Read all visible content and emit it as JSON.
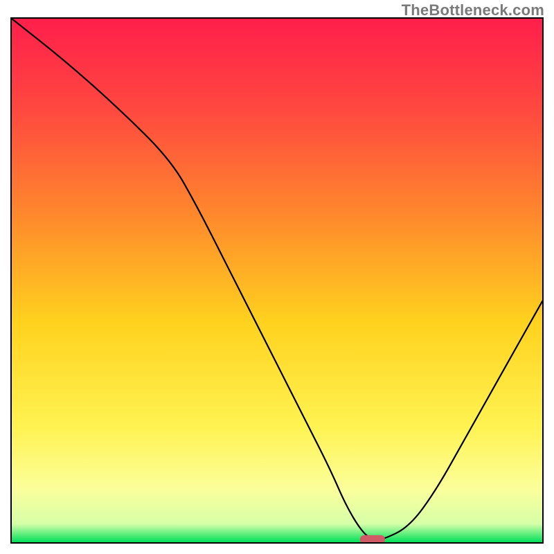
{
  "watermark": "TheBottleneck.com",
  "colors": {
    "gradient_stops": [
      {
        "offset": 0.0,
        "color": "#ff1f4b"
      },
      {
        "offset": 0.18,
        "color": "#ff4a3f"
      },
      {
        "offset": 0.38,
        "color": "#ff8a2c"
      },
      {
        "offset": 0.58,
        "color": "#ffd21e"
      },
      {
        "offset": 0.78,
        "color": "#fff352"
      },
      {
        "offset": 0.9,
        "color": "#fbff9c"
      },
      {
        "offset": 0.965,
        "color": "#d6ffa8"
      },
      {
        "offset": 1.0,
        "color": "#00e05a"
      }
    ],
    "curve": "#000000",
    "marker": "#d05a66",
    "frame": "#000000"
  },
  "chart_data": {
    "type": "line",
    "title": "",
    "xlabel": "",
    "ylabel": "",
    "xlim": [
      0,
      100
    ],
    "ylim": [
      0,
      100
    ],
    "legend": false,
    "grid": false,
    "x": [
      0,
      10,
      20,
      30,
      35,
      40,
      45,
      50,
      55,
      60,
      63,
      66,
      68,
      70,
      75,
      80,
      85,
      90,
      95,
      100
    ],
    "values": [
      100,
      92,
      83,
      73,
      64,
      54,
      44,
      34,
      24,
      14,
      7,
      2,
      0.5,
      0.5,
      3,
      10,
      19,
      28,
      37,
      46
    ],
    "marker": {
      "x": 68,
      "y": 0.5
    },
    "notes": "x and y are in percent of plot area; y=0 is bottom (green band), y=100 is top (red). Curve descends steeply from top-left, flattens near the bottom around x≈63–70 (minimum / ideal point), then rises to the right. Values estimated from pixels; no numeric axis labels are present."
  }
}
